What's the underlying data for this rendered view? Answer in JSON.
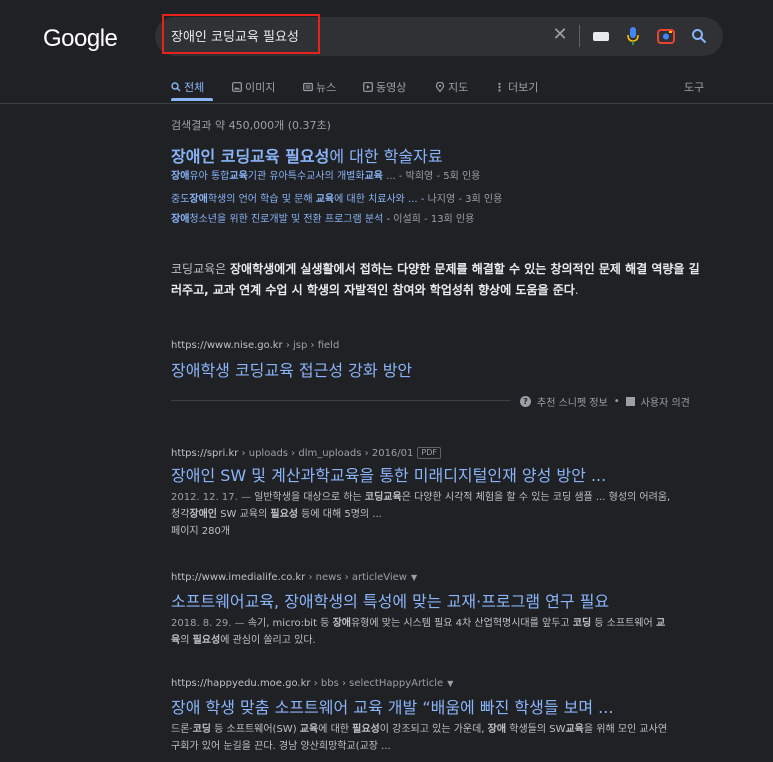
{
  "logo": "Google",
  "search": {
    "query": "장애인 코딩교육 필요성",
    "icons": [
      "close-icon",
      "keyboard-icon",
      "mic-icon",
      "lens-icon",
      "search-icon"
    ]
  },
  "tabs": [
    {
      "label": "전체",
      "icon": "search-icon",
      "active": true
    },
    {
      "label": "이미지",
      "icon": "image-icon"
    },
    {
      "label": "뉴스",
      "icon": "news-icon"
    },
    {
      "label": "동영상",
      "icon": "play-icon"
    },
    {
      "label": "지도",
      "icon": "pin-icon"
    },
    {
      "label": "더보기",
      "icon": "more-icon"
    }
  ],
  "tools_label": "도구",
  "stats": "검색결과 약 450,000개 (0.37초)",
  "scholar": {
    "title_bold": "장애인 코딩교육 필요성",
    "title_rest": "에 대한 학술자료",
    "rows": [
      {
        "b1": "장애",
        "t1": "유아 통합",
        "b2": "교육",
        "t2": "기관 유아특수교사의 개별화",
        "b3": "교육",
        "t3": " ... - ",
        "author": "박희영",
        "cite": " - 5회 인용"
      },
      {
        "t0": "중도",
        "b1": "장애",
        "t1": "학생의 언어 학습 및 문해 ",
        "b2": "교육",
        "t2": "에 대한 치료사와 ... - ",
        "author": "나지영",
        "cite": " - 3회 인용"
      },
      {
        "b1": "장애",
        "t1": "청소년을 위한 진로개발 및 전환 프로그램 분석 - ",
        "author": "이설희",
        "cite": " - 13회 인용"
      }
    ]
  },
  "snippet": {
    "s1": "코딩교육은 ",
    "b1": "장애학생에게 실생활에서 접하는 다양한 문제를 해결할 수 있는 창의적인 문제 해결 역량을 길러주고, 교과 연계 수업 시 학생의 자발적인 참여와 학업성취 향상에 도움을 준다",
    "s2": ".",
    "url_domain": "https://www.nise.go.kr",
    "url_path": " › jsp › field",
    "title": "장애학생 코딩교육 접근성 강화 방안",
    "feedback1": "추천 스니펫 정보",
    "dot": "•",
    "feedback2": "사용자 의견"
  },
  "results": [
    {
      "domain": "https://spri.kr",
      "path": " › uploads › dlm_uploads › 2016/01",
      "tag": "PDF",
      "title": "장애인 SW 및 계산과학교육을 통한 미래디지털인재 양성 방안 ...",
      "date": "2012. 12. 17. — ",
      "d1": "일반학생을 대상으로 하는 ",
      "db1": "코딩교육",
      "d2": "은 다양한 시각적 체험을 할 수 있는 코딩 샘플 ... 형성의 어려움, 청각",
      "db2": "장애인",
      "d3": " SW 교육의 ",
      "db3": "필요성",
      "d4": " 등에 대해 5명의 ...",
      "extra": "페이지 280개"
    },
    {
      "domain": "http://www.imedialife.co.kr",
      "path": " › news › articleView",
      "title": "소프트웨어교육, 장애학생의 특성에 맞는 교재·프로그램 연구 필요",
      "date": "2018. 8. 29. — ",
      "d1": "속기, micro:bit 등 ",
      "db1": "장애",
      "d2": "유형에 맞는 시스템 필요 4차 산업혁명시대를 앞두고 ",
      "db2": "코딩",
      "d3": " 등 소프트웨어 ",
      "db3": "교육",
      "d4": "의 ",
      "db4": "필요성",
      "d5": "에 관심이 쏠리고 있다."
    },
    {
      "domain": "https://happyedu.moe.go.kr",
      "path": " › bbs › selectHappyArticle",
      "title": "장애 학생 맞춤 소프트웨어 교육 개발 “배움에 빠진 학생들 보며 ...",
      "d1": "드론·",
      "db1": "코딩",
      "d2": " 등 소프트웨어(SW) ",
      "db2": "교육",
      "d3": "에 대한 ",
      "db3": "필요성",
      "d4": "이 강조되고 있는 가운데, ",
      "db4": "장애",
      "d5": " 학생들의 SW",
      "db5": "교육",
      "d6": "을 위해 모인 교사연구회가 있어 눈길을 끈다. 경남 양산희망학교(교장 ..."
    }
  ],
  "colors": {
    "background": "#202124",
    "link": "#8ab4f8",
    "text": "#bdc1c6",
    "highlight_box": "#e8221b"
  }
}
